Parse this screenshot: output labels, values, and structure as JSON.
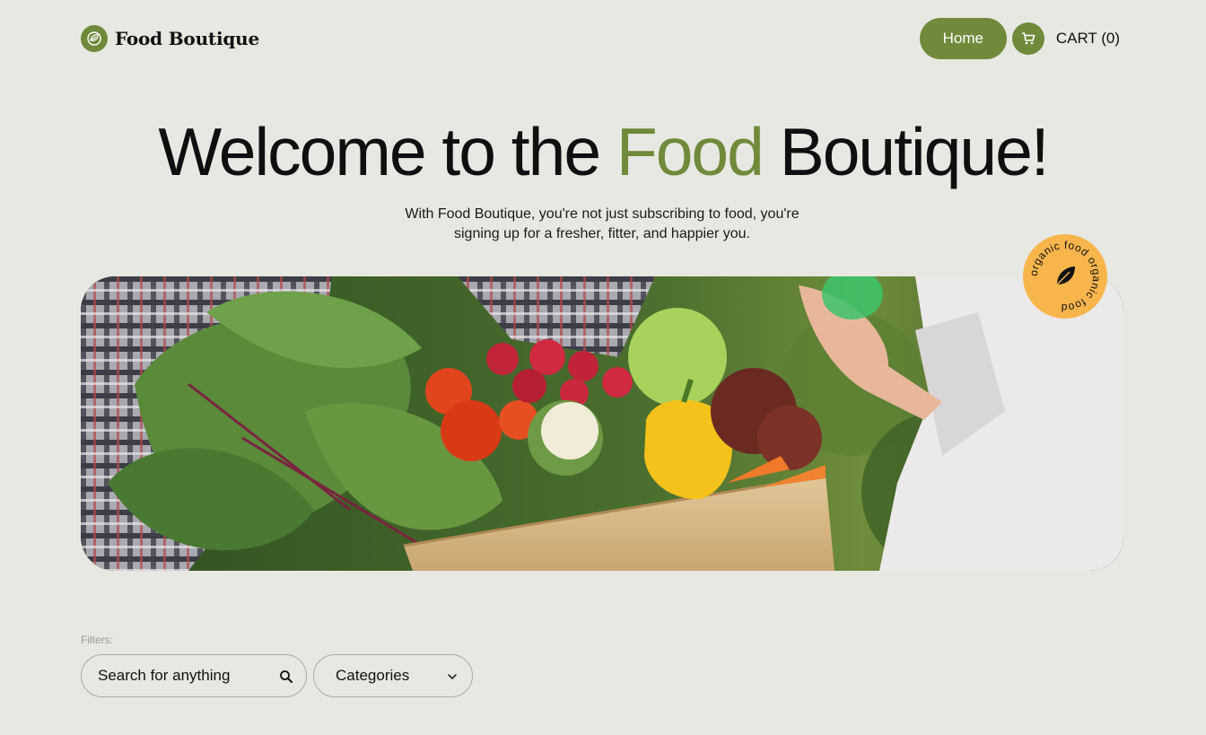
{
  "header": {
    "brand": "Food Boutique",
    "nav": {
      "home_label": "Home",
      "cart_label": "CART (0)"
    }
  },
  "hero": {
    "title_prefix": "Welcome to the ",
    "title_accent": "Food",
    "title_suffix": " Boutique!",
    "subtitle": "With Food Boutique, you're not just subscribing to food, you're signing up for a fresher, fitter, and happier you.",
    "badge_text": "organic food organic food"
  },
  "filters": {
    "label": "Filters:",
    "search_placeholder": "Search for anything",
    "categories_label": "Categories"
  },
  "icons": {
    "logo": "leaf-circle-icon",
    "cart": "cart-icon",
    "search": "search-icon",
    "chevron": "chevron-down-icon",
    "badge_leaf": "leaf-icon"
  },
  "colors": {
    "accent": "#6f8a3a",
    "background": "#e7e8e2",
    "badge": "#f7b54c"
  }
}
